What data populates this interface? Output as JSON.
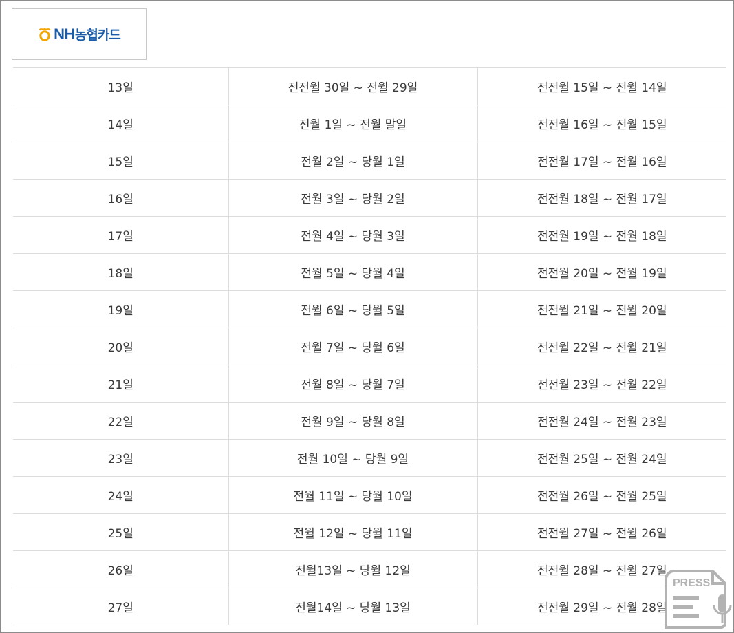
{
  "logo": {
    "brand_latin": "NH",
    "brand_korean": "농협카드",
    "color": "#1a5ca8",
    "mark_color": "#f0a500"
  },
  "table": {
    "rows": [
      [
        "13일",
        "전전월 30일 ~ 전월 29일",
        "전전월 15일 ~ 전월 14일"
      ],
      [
        "14일",
        "전월 1일 ~ 전월 말일",
        "전전월 16일 ~ 전월 15일"
      ],
      [
        "15일",
        "전월 2일 ~ 당월 1일",
        "전전월 17일 ~ 전월 16일"
      ],
      [
        "16일",
        "전월 3일 ~ 당월 2일",
        "전전월 18일 ~ 전월 17일"
      ],
      [
        "17일",
        "전월 4일 ~ 당월 3일",
        "전전월 19일 ~ 전월 18일"
      ],
      [
        "18일",
        "전월 5일 ~ 당월 4일",
        "전전월 20일 ~ 전월 19일"
      ],
      [
        "19일",
        "전월 6일 ~ 당월 5일",
        "전전월 21일 ~ 전월 20일"
      ],
      [
        "20일",
        "전월 7일 ~ 당월 6일",
        "전전월 22일 ~ 전월 21일"
      ],
      [
        "21일",
        "전월 8일 ~ 당월 7일",
        "전전월 23일 ~ 전월 22일"
      ],
      [
        "22일",
        "전월 9일 ~ 당월 8일",
        "전전월 24일 ~ 전월 23일"
      ],
      [
        "23일",
        "전월 10일 ~ 당월 9일",
        "전전월 25일 ~ 전월 24일"
      ],
      [
        "24일",
        "전월 11일 ~ 당월 10일",
        "전전월 26일 ~ 전월 25일"
      ],
      [
        "25일",
        "전월 12일 ~ 당월 11일",
        "전전월 27일 ~ 전월 26일"
      ],
      [
        "26일",
        "전월13일 ~ 당월 12일",
        "전전월 28일 ~ 전월 27일"
      ],
      [
        "27일",
        "전월14일 ~ 당월 13일",
        "전전월 29일 ~ 전월 28일"
      ]
    ]
  },
  "watermark": {
    "text": "PRESS",
    "icon": "press-document-icon",
    "color": "#9a9a9a"
  }
}
